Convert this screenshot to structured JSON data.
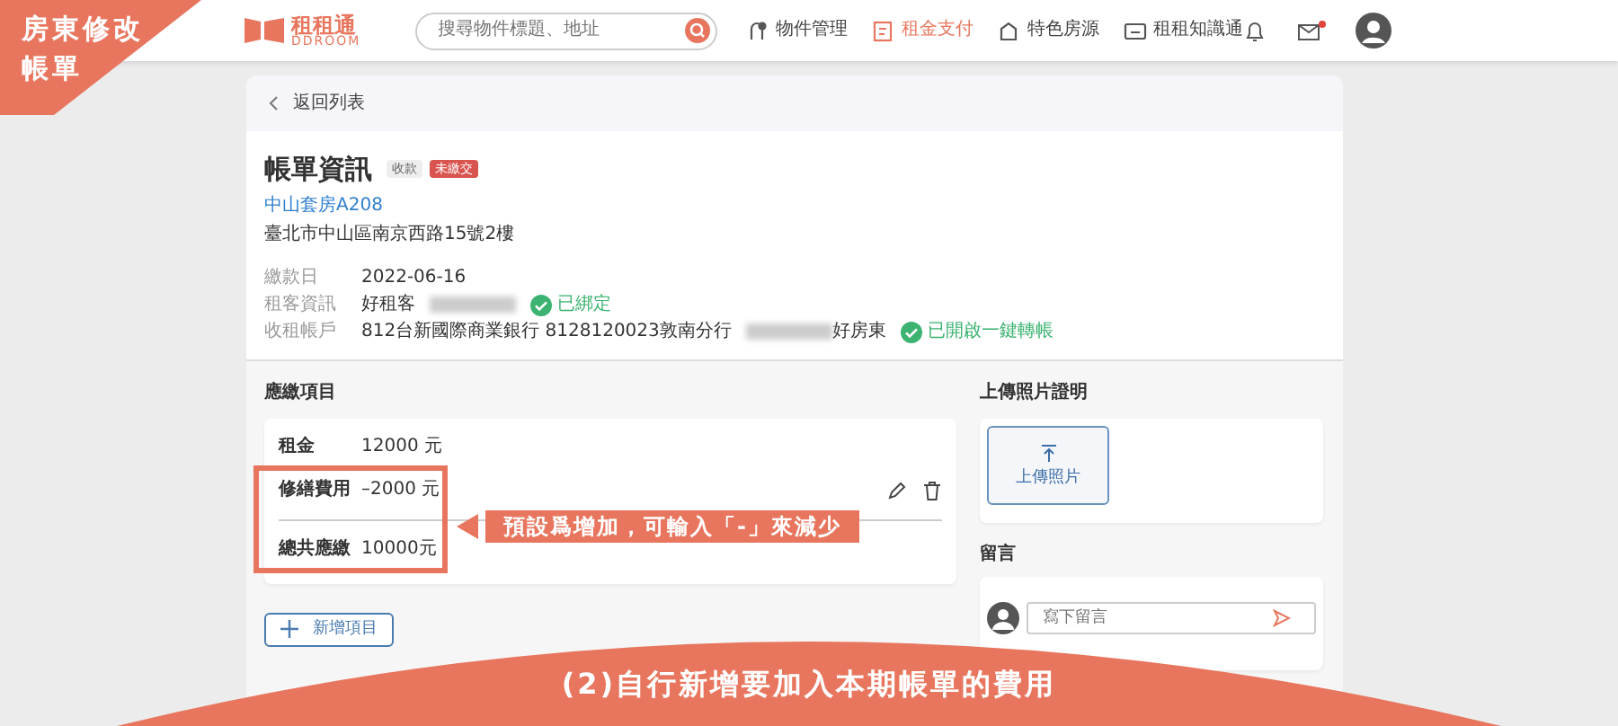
{
  "overlay": {
    "corner_lines": [
      "房東修改",
      "帳單"
    ],
    "callout": "預設爲增加，可輸入「-」來減少",
    "banner": "(2)自行新增要加入本期帳單的費用"
  },
  "header": {
    "logo": "租租通",
    "logo_sub": "DDROOM",
    "search": {
      "placeholder": "搜尋物件標題、地址"
    },
    "nav": [
      {
        "label": "物件管理",
        "selected": false
      },
      {
        "label": "租金支付",
        "selected": true
      },
      {
        "label": "特色房源",
        "selected": false
      },
      {
        "label": "租租知識通",
        "selected": false
      }
    ],
    "mail_unread": true
  },
  "back_link": "返回列表",
  "bill": {
    "title": "帳單資訊",
    "tags": [
      {
        "label": "收款",
        "kind": "neutral"
      },
      {
        "label": "未繳交",
        "kind": "danger"
      }
    ],
    "property": "中山套房A208",
    "address": "臺北市中山區南京西路15號2樓",
    "fields": [
      {
        "label": "繳款日",
        "value": "2022-06-16",
        "redacted": false
      },
      {
        "label": "租客資訊",
        "value": "好租客",
        "redacted": true,
        "status": "已綁定"
      },
      {
        "label": "收租帳戶",
        "value": "812台新國際商業銀行 8128120023敦南分行",
        "redacted": true,
        "value_after": "好房東",
        "status": "已開啟一鍵轉帳"
      }
    ]
  },
  "items": {
    "title": "應繳項目",
    "rows": [
      {
        "label": "租金",
        "amount": "12000 元",
        "editable": false
      },
      {
        "label": "修繕費用",
        "amount": "–2000 元",
        "editable": true
      }
    ],
    "total": {
      "label": "總共應繳",
      "amount": "10000元"
    },
    "add_button": "新增項目"
  },
  "upload": {
    "title": "上傳照片證明",
    "button": "上傳照片"
  },
  "comments": {
    "title": "留言",
    "placeholder": "寫下留言"
  }
}
